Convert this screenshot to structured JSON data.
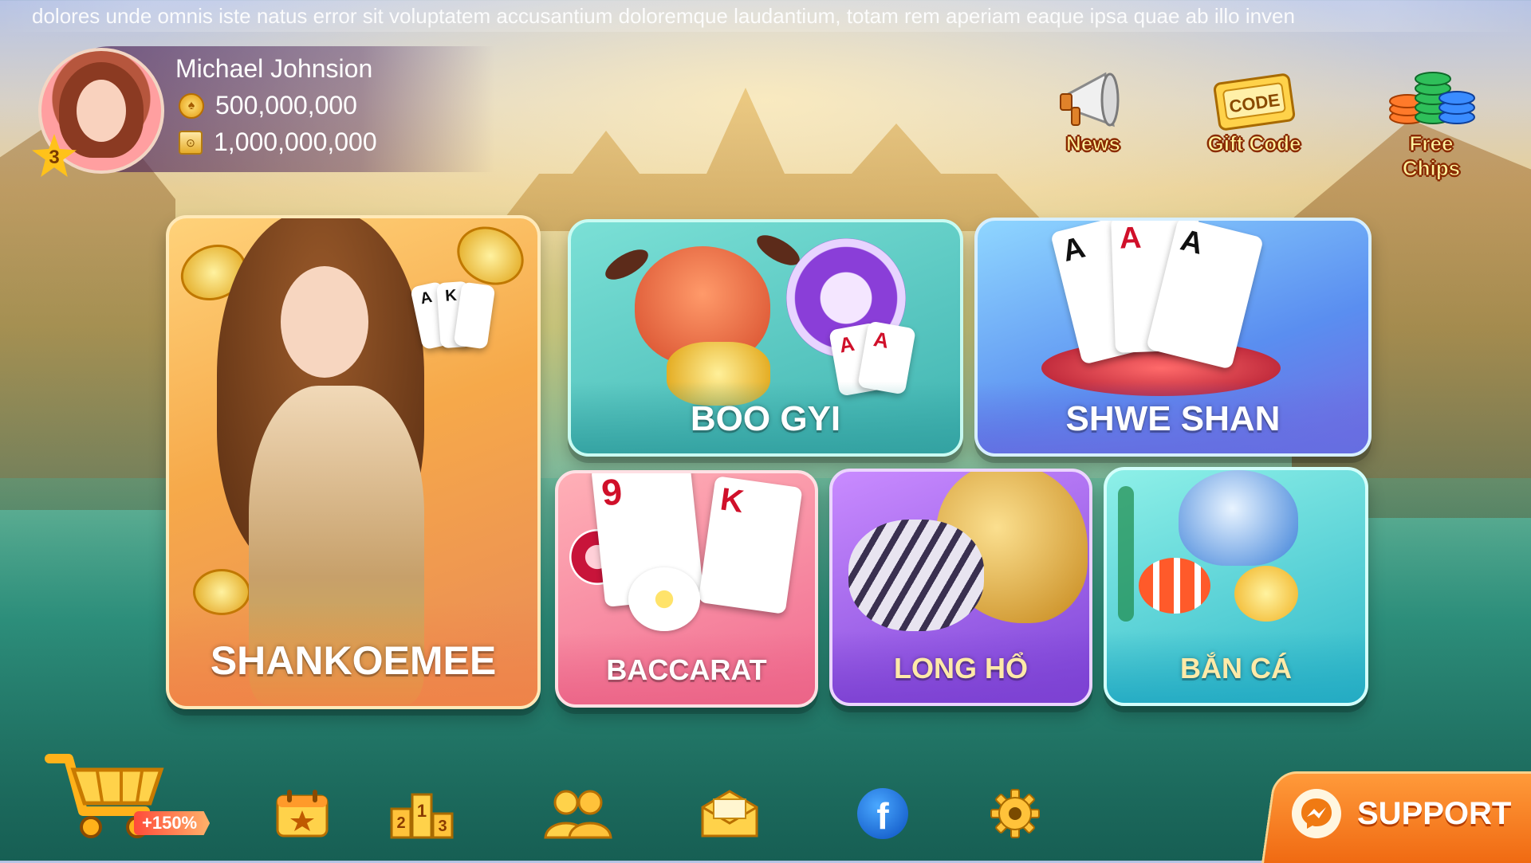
{
  "marquee": {
    "text": "dolores unde omnis iste natus error sit voluptatem accusantium doloremque laudantium, totam rem aperiam eaque ipsa quae ab illo inven"
  },
  "profile": {
    "username": "Michael Johnsion",
    "level": "3",
    "coins": "500,000,000",
    "tickets": "1,000,000,000"
  },
  "top_actions": [
    {
      "label": "News",
      "icon": "megaphone-icon"
    },
    {
      "label": "Gift Code",
      "badge": "CODE",
      "icon": "gift-code-ticket-icon"
    },
    {
      "label": "Free Chips",
      "icon": "chip-stack-icon"
    }
  ],
  "games": {
    "shankoemee": "SHANKOEMEE",
    "boo_gyi": "BOO GYI",
    "shwe_shan": "SHWE SHAN",
    "baccarat": "BACCARAT",
    "long_ho": "LONG HỔ",
    "ban_ca": "BẮN CÁ"
  },
  "cards": {
    "ace": "A",
    "king": "K",
    "nine": "9"
  },
  "bottom_nav": {
    "shop_bonus": "+150%",
    "leaderboard_digits": [
      "2",
      "1",
      "3"
    ],
    "facebook": "f",
    "support_label": "SUPPORT"
  },
  "colors": {
    "accent_orange": "#f06a12",
    "label_yellow": "#fff4a0",
    "star": "#ffc21a"
  }
}
